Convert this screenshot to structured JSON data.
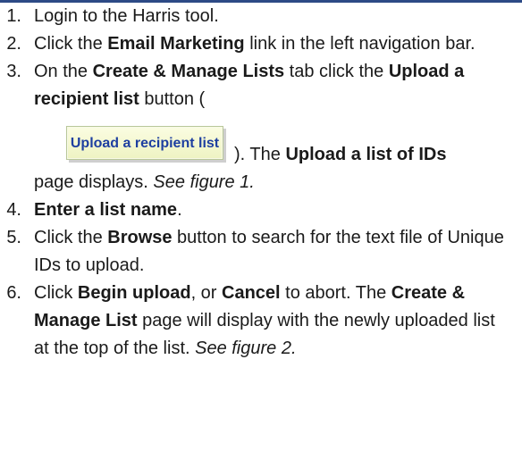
{
  "steps": [
    {
      "num": "1.",
      "text": "Login to the Harris tool."
    },
    {
      "num": "2.",
      "pre": "Click the ",
      "bold": "Email Marketing",
      "post": " link in the left navigation bar."
    },
    {
      "num": "3.",
      "pre": "On the ",
      "bold1": "Create & Manage Lists",
      "mid": " tab click the ",
      "bold2": "Upload a recipient list",
      "post": " button (",
      "button_label": "Upload a recipient list",
      "after_btn": "). The ",
      "bold3": "Upload a list of IDs",
      "post2": " page displays. ",
      "italic": "See figure 1."
    },
    {
      "num": "4.",
      "bold": "Enter a list name",
      "post": "."
    },
    {
      "num": "5.",
      "pre": "Click the ",
      "bold": "Browse",
      "post": " button to search for the text file of Unique IDs to upload."
    },
    {
      "num": "6.",
      "pre": "Click ",
      "bold1": "Begin upload",
      "mid": ", or ",
      "bold2": "Cancel",
      "mid2": " to abort. The ",
      "bold3": "Create & Manage List",
      "post": " page will display with the newly uploaded list at the top of the list.  ",
      "italic": "See figure 2."
    }
  ],
  "colors": {
    "rule": "#2d4a86",
    "button_text": "#1e3fa0",
    "button_bg": "#eef3c2"
  }
}
